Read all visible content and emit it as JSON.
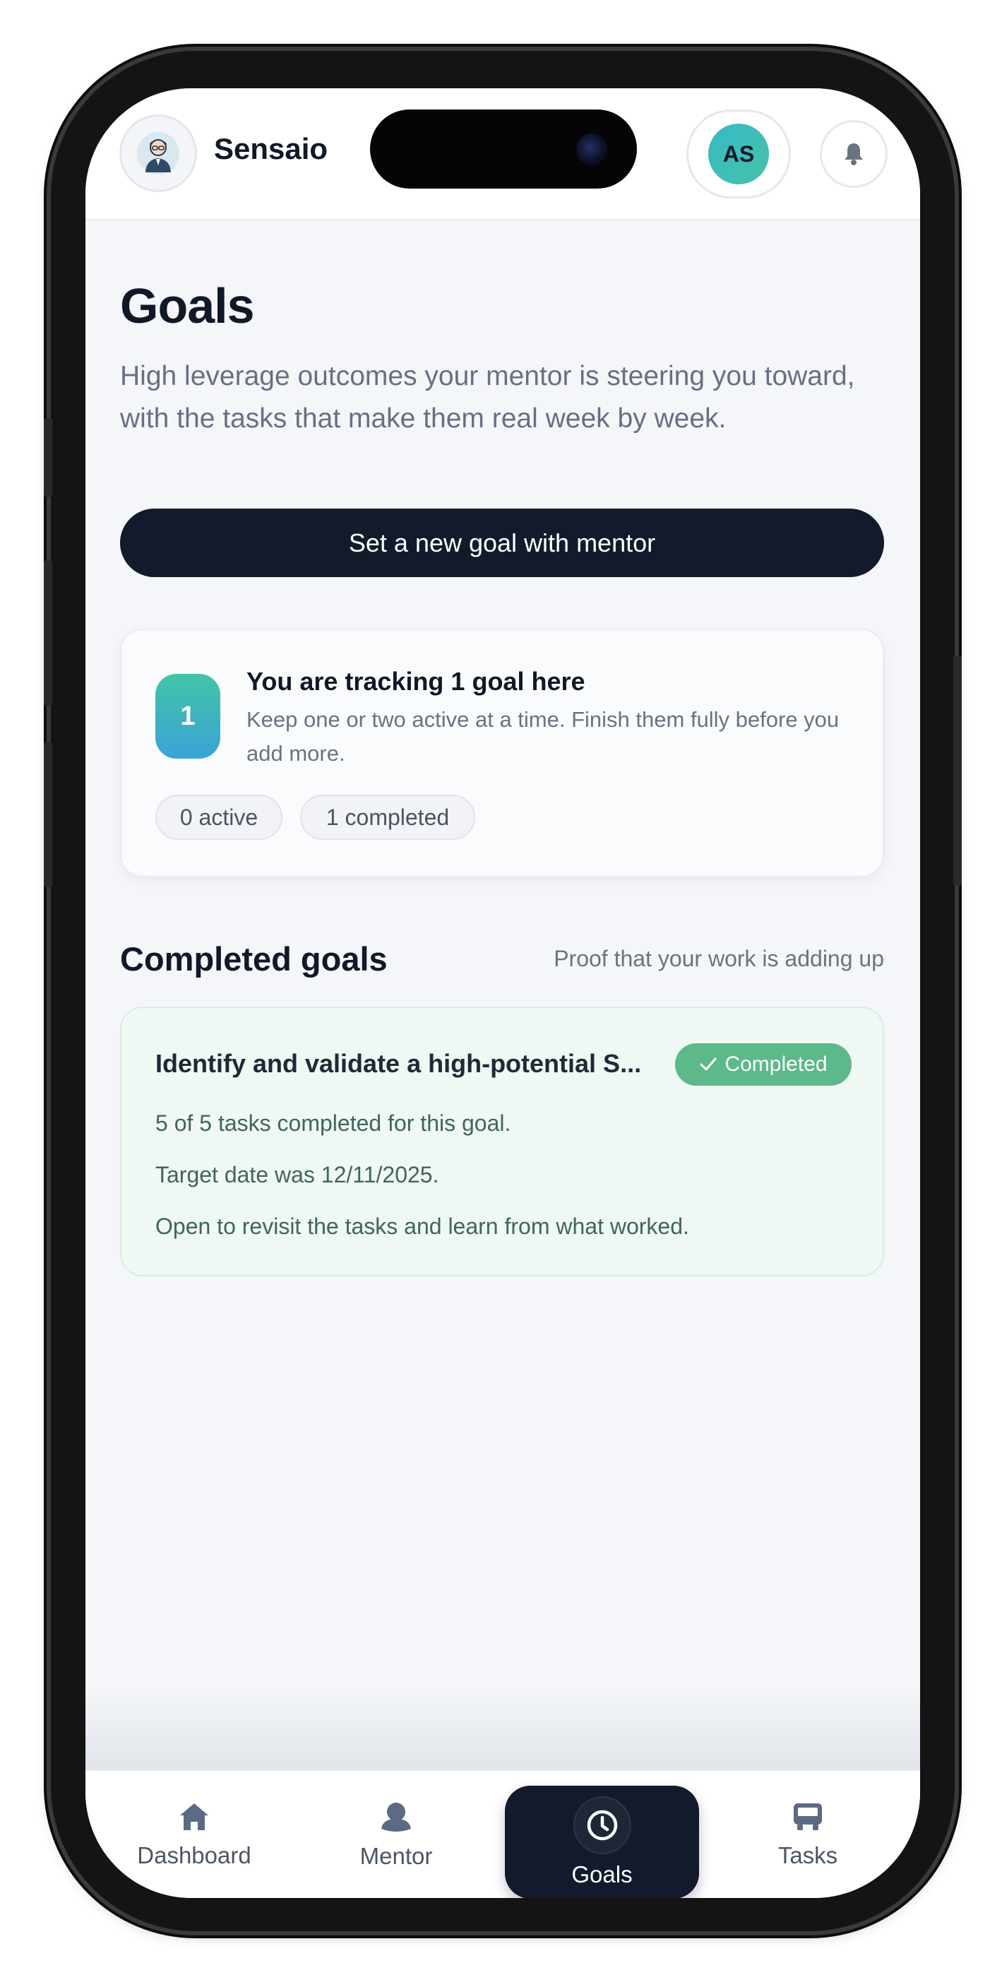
{
  "app": {
    "name": "Sensaio",
    "user_initials": "AS",
    "accent_colors": {
      "primary_dark": "#131a2b",
      "success": "#5db88a",
      "teal": "#3cbfb6"
    }
  },
  "header": {
    "logo_icon": "mentor-avatar-icon",
    "notification_icon": "bell-icon"
  },
  "page": {
    "title": "Goals",
    "subtitle": "High leverage outcomes your mentor is steering you toward, with the tasks that make them real week by week.",
    "cta_label": "Set a new goal with mentor"
  },
  "summary": {
    "count": "1",
    "heading": "You are tracking 1 goal here",
    "text": "Keep one or two active at a time. Finish them fully before you add more.",
    "active_pill": "0 active",
    "completed_pill": "1 completed"
  },
  "completed_section": {
    "title": "Completed goals",
    "note": "Proof that your work is adding up",
    "goals": [
      {
        "title": "Identify and validate a high-potential S...",
        "badge": "Completed",
        "badge_icon": "check-icon",
        "progress_text": "5 of 5 tasks completed for this goal.",
        "target_text": "Target date was 12/11/2025.",
        "hint_text": "Open to revisit the tasks and learn from what worked."
      }
    ]
  },
  "nav": {
    "items": [
      {
        "label": "Dashboard",
        "icon": "home-icon"
      },
      {
        "label": "Mentor",
        "icon": "mentor-icon"
      },
      {
        "label": "Goals",
        "icon": "clock-icon",
        "active": true
      },
      {
        "label": "Tasks",
        "icon": "tasks-icon"
      }
    ]
  }
}
